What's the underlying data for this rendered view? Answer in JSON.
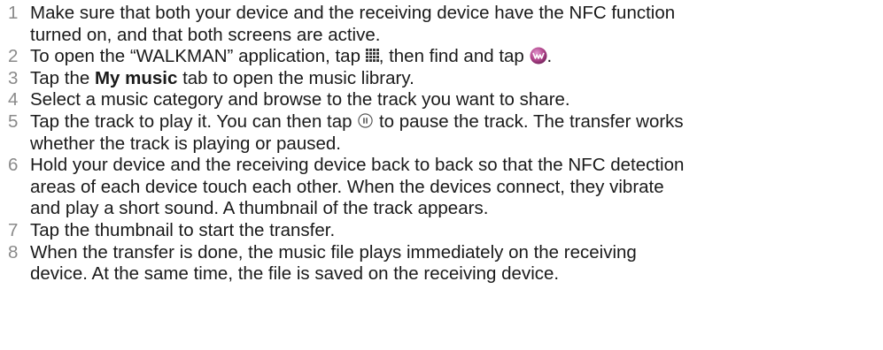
{
  "steps": [
    {
      "number": "1",
      "lines": [
        "Make sure that both your device and the receiving device have the NFC function",
        "turned on, and that both screens are active."
      ]
    },
    {
      "number": "2",
      "text_a": "To open the “WALKMAN” application, tap ",
      "text_b": ", then find and tap ",
      "text_c": ".",
      "icon_1": "apps-grid-icon",
      "icon_2": "walkman-app-icon"
    },
    {
      "number": "3",
      "text_a": "Tap the ",
      "bold": "My music",
      "text_b": " tab to open the music library."
    },
    {
      "number": "4",
      "lines": [
        "Select a music category and browse to the track you want to share."
      ]
    },
    {
      "number": "5",
      "text_a": "Tap the track to play it. You can then tap ",
      "text_b": " to pause the track. The transfer works",
      "line_2": "whether the track is playing or paused.",
      "icon": "pause-icon"
    },
    {
      "number": "6",
      "lines": [
        "Hold your device and the receiving device back to back so that the NFC detection",
        "areas of each device touch each other. When the devices connect, they vibrate",
        "and play a short sound. A thumbnail of the track appears."
      ]
    },
    {
      "number": "7",
      "lines": [
        "Tap the thumbnail to start the transfer."
      ]
    },
    {
      "number": "8",
      "lines": [
        "When the transfer is done, the music file plays immediately on the receiving",
        "device. At the same time, the file is saved on the receiving device."
      ]
    }
  ],
  "colors": {
    "text": "#1a1a1a",
    "step_number": "#8a8a8a",
    "walkman_icon": "#b0448a"
  }
}
